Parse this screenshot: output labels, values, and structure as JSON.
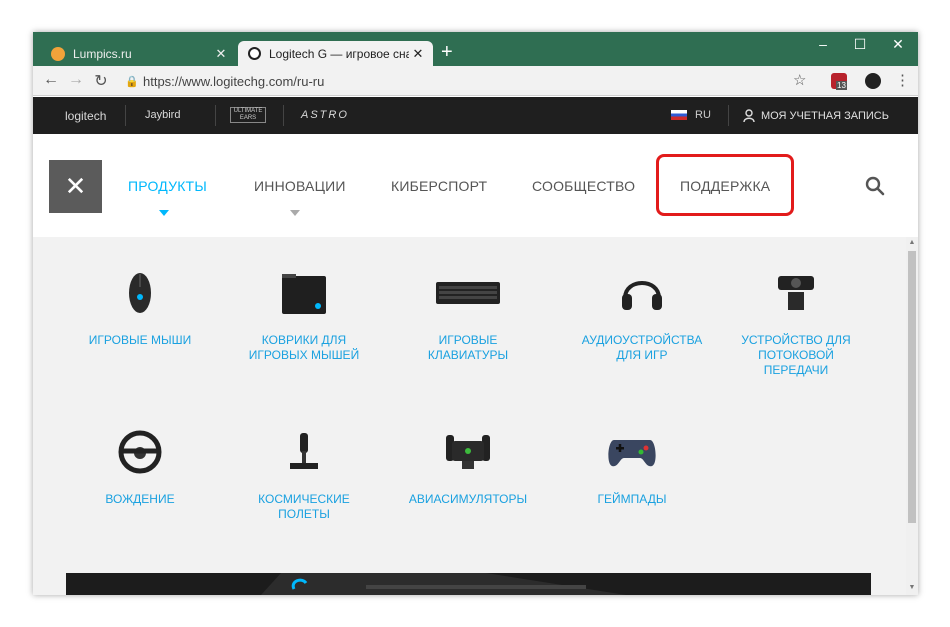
{
  "browser": {
    "tabs": [
      {
        "title": "Lumpics.ru",
        "favicon": "lumpics-orange-circle",
        "color": "#f2a33a"
      },
      {
        "title": "Logitech G — игровое снаряже",
        "favicon": "logitech-g-icon",
        "color": "#1aa1e0"
      }
    ],
    "new_tab": "+",
    "window_controls": {
      "minimize": "–",
      "maximize": "☐",
      "close": "✕"
    },
    "url": "https://www.logitechg.com/ru-ru",
    "ext_badge": "13"
  },
  "brandbar": {
    "brands": [
      "logitech",
      "Jaybird",
      "ULTIMATE EARS",
      "ASTRO"
    ],
    "lang": "RU",
    "account": "МОЯ УЧЕТНАЯ ЗАПИСЬ"
  },
  "mainnav": {
    "close": "✕",
    "items": [
      "ПРОДУКТЫ",
      "ИННОВАЦИИ",
      "КИБЕРСПОРТ",
      "СООБЩЕСТВО",
      "ПОДДЕРЖКА"
    ],
    "active_item": "ПРОДУКТЫ",
    "highlighted_item": "ПОДДЕРЖКА",
    "accent_color": "#00b8fc",
    "highlight_color": "#e21b1b"
  },
  "products": [
    {
      "label": "ИГРОВЫЕ МЫШИ",
      "icon": "gaming-mouse-icon"
    },
    {
      "label": "КОВРИКИ ДЛЯ ИГРОВЫХ МЫШЕЙ",
      "icon": "mousepad-icon"
    },
    {
      "label": "ИГРОВЫЕ КЛАВИАТУРЫ",
      "icon": "keyboard-icon"
    },
    {
      "label": "АУДИОУСТРОЙСТВА ДЛЯ ИГР",
      "icon": "headset-icon"
    },
    {
      "label": "УСТРОЙСТВО ДЛЯ ПОТОКОВОЙ ПЕРЕДАЧИ",
      "icon": "webcam-icon"
    },
    {
      "label": "ВОЖДЕНИЕ",
      "icon": "steering-wheel-icon"
    },
    {
      "label": "КОСМИЧЕСКИЕ ПОЛЕТЫ",
      "icon": "joystick-icon"
    },
    {
      "label": "АВИАСИМУЛЯТОРЫ",
      "icon": "flight-yoke-icon"
    },
    {
      "label": "ГЕЙМПАДЫ",
      "icon": "gamepad-icon"
    }
  ]
}
